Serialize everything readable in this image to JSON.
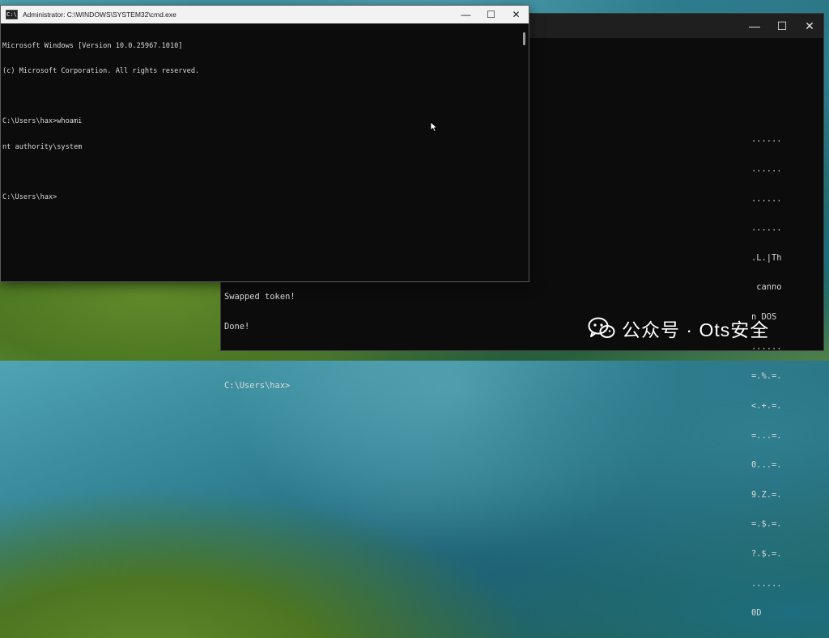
{
  "front_window": {
    "title": "Administrator: C:\\WINDOWS\\SYSTEM32\\cmd.exe",
    "icon": "cmd-icon",
    "console_lines": [
      "Microsoft Windows [Version 10.0.25967.1010]",
      "(c) Microsoft Corporation. All rights reserved.",
      "",
      "C:\\Users\\hax>whoami",
      "nt authority\\system",
      "",
      "C:\\Users\\hax>"
    ]
  },
  "back_window": {
    "right_fragments": [
      "......",
      "......",
      "......",
      "......",
      ".L.|Th",
      " canno",
      "n DOS",
      "......",
      "=.%.=.",
      "<.+.=.",
      "=...=.",
      "0...=.",
      "9.Z.=.",
      "=.$.=.",
      "?.$.=.",
      "......",
      "0D"
    ],
    "bottom_lines": [
      "Swapped token!",
      "Done!",
      "",
      "C:\\Users\\hax>"
    ]
  },
  "window_controls": {
    "minimize": "—",
    "maximize": "☐",
    "close": "✕"
  },
  "watermark": {
    "text": "公众号 · Ots安全",
    "icon": "wechat-icon"
  }
}
